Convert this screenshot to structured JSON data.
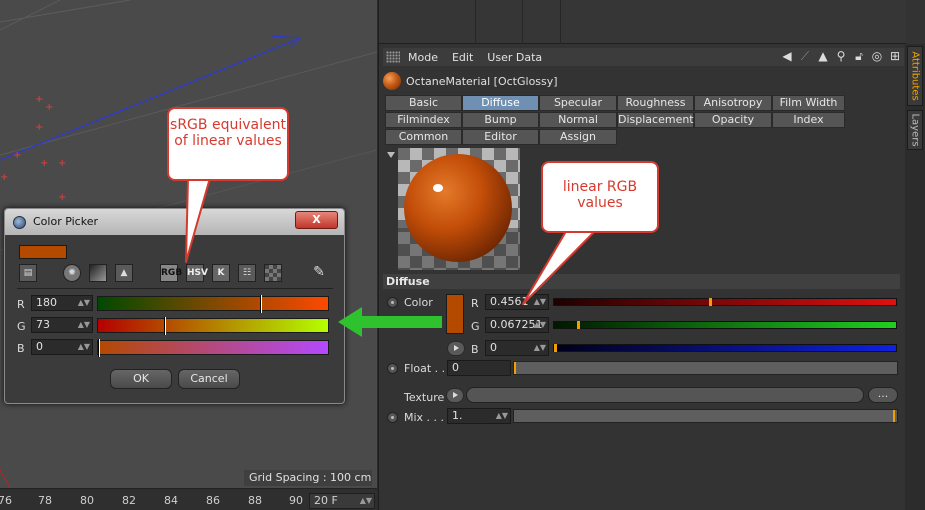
{
  "viewport": {
    "grid_spacing": "Grid Spacing : 100 cm"
  },
  "timeline": {
    "ticks": [
      "76",
      "78",
      "80",
      "82",
      "84",
      "86",
      "88",
      "90"
    ],
    "frame": "20 F"
  },
  "attributes": {
    "menu": [
      "Mode",
      "Edit",
      "User Data"
    ],
    "material_name": "OctaneMaterial [OctGlossy]",
    "tabs_row1": [
      "Basic",
      "Diffuse",
      "Specular",
      "Roughness",
      "Anisotropy",
      "Film Width"
    ],
    "tabs_row2": [
      "Filmindex",
      "Bump",
      "Normal",
      "Displacement",
      "Opacity",
      "Index"
    ],
    "tabs_row3": [
      "Common",
      "Editor",
      "Assign"
    ],
    "active_tab": "Diffuse",
    "section": "Diffuse",
    "color_label": "Color",
    "r_label": "R",
    "g_label": "G",
    "b_label": "B",
    "r_value": "0.4561",
    "g_value": "0.067251",
    "b_value": "0",
    "r_fraction": 0.4561,
    "g_fraction": 0.067251,
    "b_fraction": 0,
    "float_label": "Float . .",
    "float_value": "0",
    "texture_label": "Texture",
    "texture_more": "...",
    "mix_label": "Mix . . .",
    "mix_value": "1.",
    "side_tabs": [
      "Attributes",
      "Layers"
    ],
    "swatch_color": "#b44900"
  },
  "color_picker": {
    "title": "Color Picker",
    "close": "X",
    "mode_rgb": "RGB",
    "mode_hsv": "HSV",
    "mode_k": "K",
    "r_label": "R",
    "g_label": "G",
    "b_label": "B",
    "r_value": "180",
    "g_value": "73",
    "b_value": "0",
    "ok": "OK",
    "cancel": "Cancel"
  },
  "callouts": {
    "srgb": "sRGB equivalent of linear values",
    "linear": "linear RGB values"
  },
  "colors": {
    "accent_tab": "#6f8fb3",
    "callout": "#d63a2e",
    "arrow": "#2fc22f"
  }
}
